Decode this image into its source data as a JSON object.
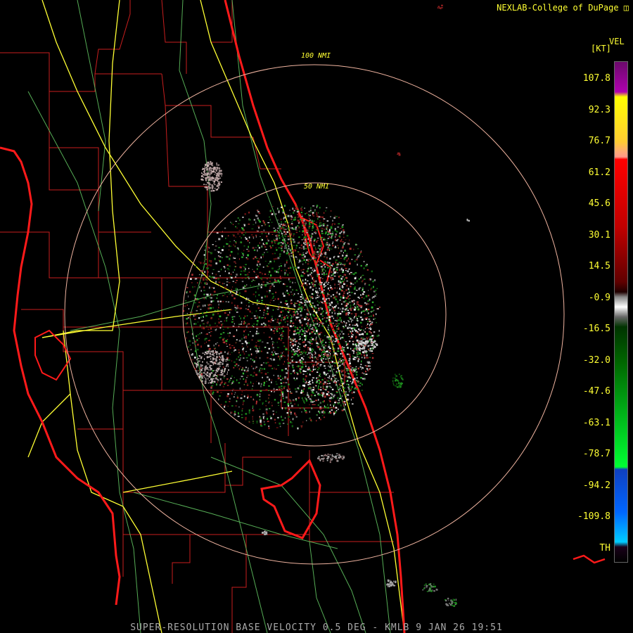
{
  "credit": "NEXLAB-College of DuPage",
  "footer": "SUPER-RESOLUTION BASE VELOCITY 0.5 DEG - KMLB 9 JAN 26 19:51",
  "legend": {
    "title": "VEL",
    "unit": "[KT]",
    "th_label": "TH",
    "ticks": [
      "107.8",
      "92.3",
      "76.7",
      "61.2",
      "45.6",
      "30.1",
      "14.5",
      "-0.9",
      "-16.5",
      "-32.0",
      "-47.6",
      "-63.1",
      "-78.7",
      "-94.2",
      "-109.8"
    ]
  },
  "range_rings": {
    "outer": "100 NMI",
    "inner": "50 NMI"
  },
  "colors": {
    "coast": "#ff1a1a",
    "county": "#c81e1e",
    "highway": "#ffff33",
    "road": "#66cc66",
    "ring": "#f0b4a0",
    "label": "#ffff33"
  }
}
